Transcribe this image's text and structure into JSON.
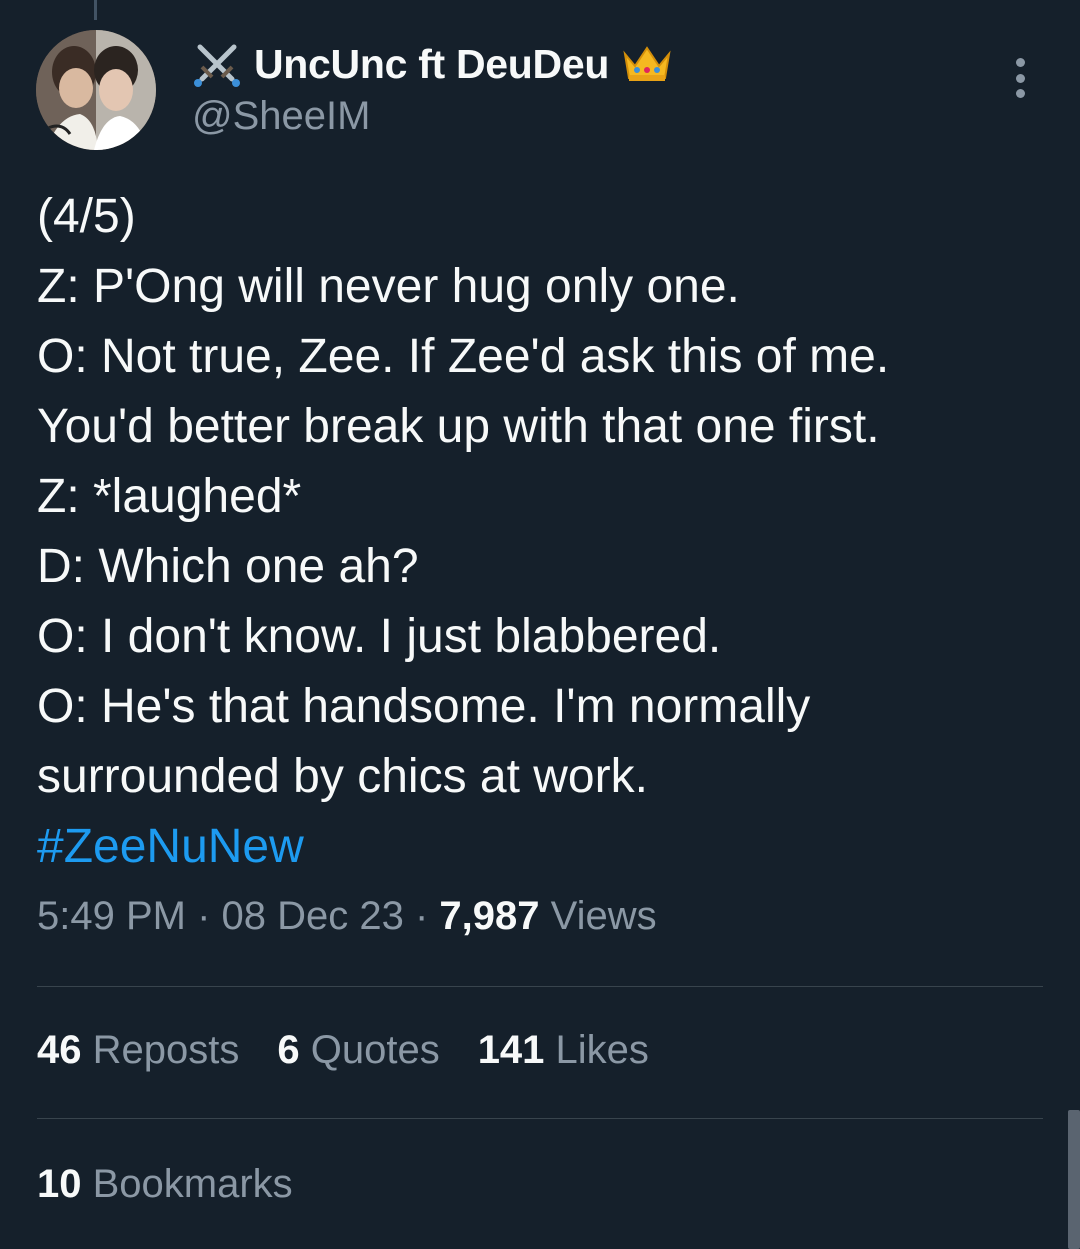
{
  "author": {
    "display_name": "UncUnc ft DeuDeu",
    "handle": "@SheeIM",
    "name_prefix_icon": "crossed-swords-icon",
    "name_suffix_icon": "crown-icon"
  },
  "tweet": {
    "lines": [
      "(4/5)",
      "Z: P'Ong will never hug only one.",
      "O: Not true, Zee. If Zee'd ask this of me.",
      "You'd better break up with that one first.",
      "Z: *laughed*",
      "D: Which one ah?",
      "O: I don't know. I just blabbered.",
      "O: He's that handsome. I'm normally",
      "surrounded by chics at work."
    ],
    "hashtag": "#ZeeNuNew"
  },
  "meta": {
    "time": "5:49 PM",
    "separator": " · ",
    "date": "08 Dec 23",
    "views_count": "7,987",
    "views_label": " Views"
  },
  "stats": {
    "reposts": {
      "count": "46",
      "label": " Reposts"
    },
    "quotes": {
      "count": "6",
      "label": " Quotes"
    },
    "likes": {
      "count": "141",
      "label": " Likes"
    },
    "bookmarks": {
      "count": "10",
      "label": " Bookmarks"
    }
  },
  "colors": {
    "background": "#15202b",
    "primary_text": "#f7f9f9",
    "secondary_text": "#8b98a5",
    "link": "#1d9bf0",
    "divider": "#38444d"
  }
}
